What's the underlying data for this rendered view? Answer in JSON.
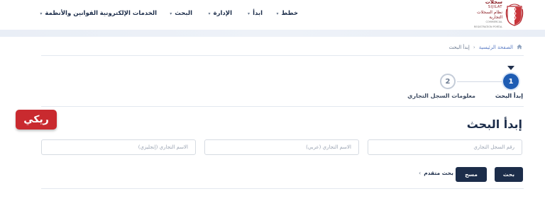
{
  "header": {
    "logo": {
      "arabic_name": "سجلات",
      "latin_name": "SIJILAT",
      "arabic_sub": "نظام السجلات التجارية",
      "latin_sub": "COMMERCIAL REGISTRATION PORTAL"
    },
    "nav": [
      {
        "label": "خطط",
        "icon": "chevron-down-icon"
      },
      {
        "label": "ابدأ",
        "icon": "chevron-down-icon"
      },
      {
        "label": "الإدارة",
        "icon": "chevron-down-icon"
      },
      {
        "label": "البحث",
        "icon": "chevron-down-icon"
      },
      {
        "label": "الخدمات الإلكترونية",
        "icon": ""
      },
      {
        "label": "القوانين والأنظمة",
        "icon": "chevron-down-icon"
      }
    ]
  },
  "breadcrumb": {
    "home_icon": "home-icon",
    "home_label": "الصفحة الرئيسية",
    "separator": "›",
    "current": "إبدأ البحث"
  },
  "stepper": {
    "steps": [
      {
        "number": "1",
        "label": "إبدأ البحث",
        "active": true
      },
      {
        "number": "2",
        "label": "معلومات السجل التجاري",
        "active": false
      }
    ]
  },
  "watermark": {
    "text": "ريكي"
  },
  "form": {
    "title": "إبدأ البحث",
    "fields": [
      {
        "placeholder": "رقم السجل التجاري",
        "value": ""
      },
      {
        "placeholder": "الاسم التجاري (عربي)",
        "value": ""
      },
      {
        "placeholder": "الاسم التجاري (إنجليزي)",
        "value": ""
      }
    ],
    "search_button": "بحث",
    "clear_button": "مسح",
    "advanced_search": "بحث متقدم",
    "advanced_icon": "chevron-left-icon"
  },
  "colors": {
    "primary_dark": "#1c2d4a",
    "step_active": "#1e5cb3",
    "watermark_red": "#c92a2f",
    "logo_red": "#8a1c22"
  }
}
